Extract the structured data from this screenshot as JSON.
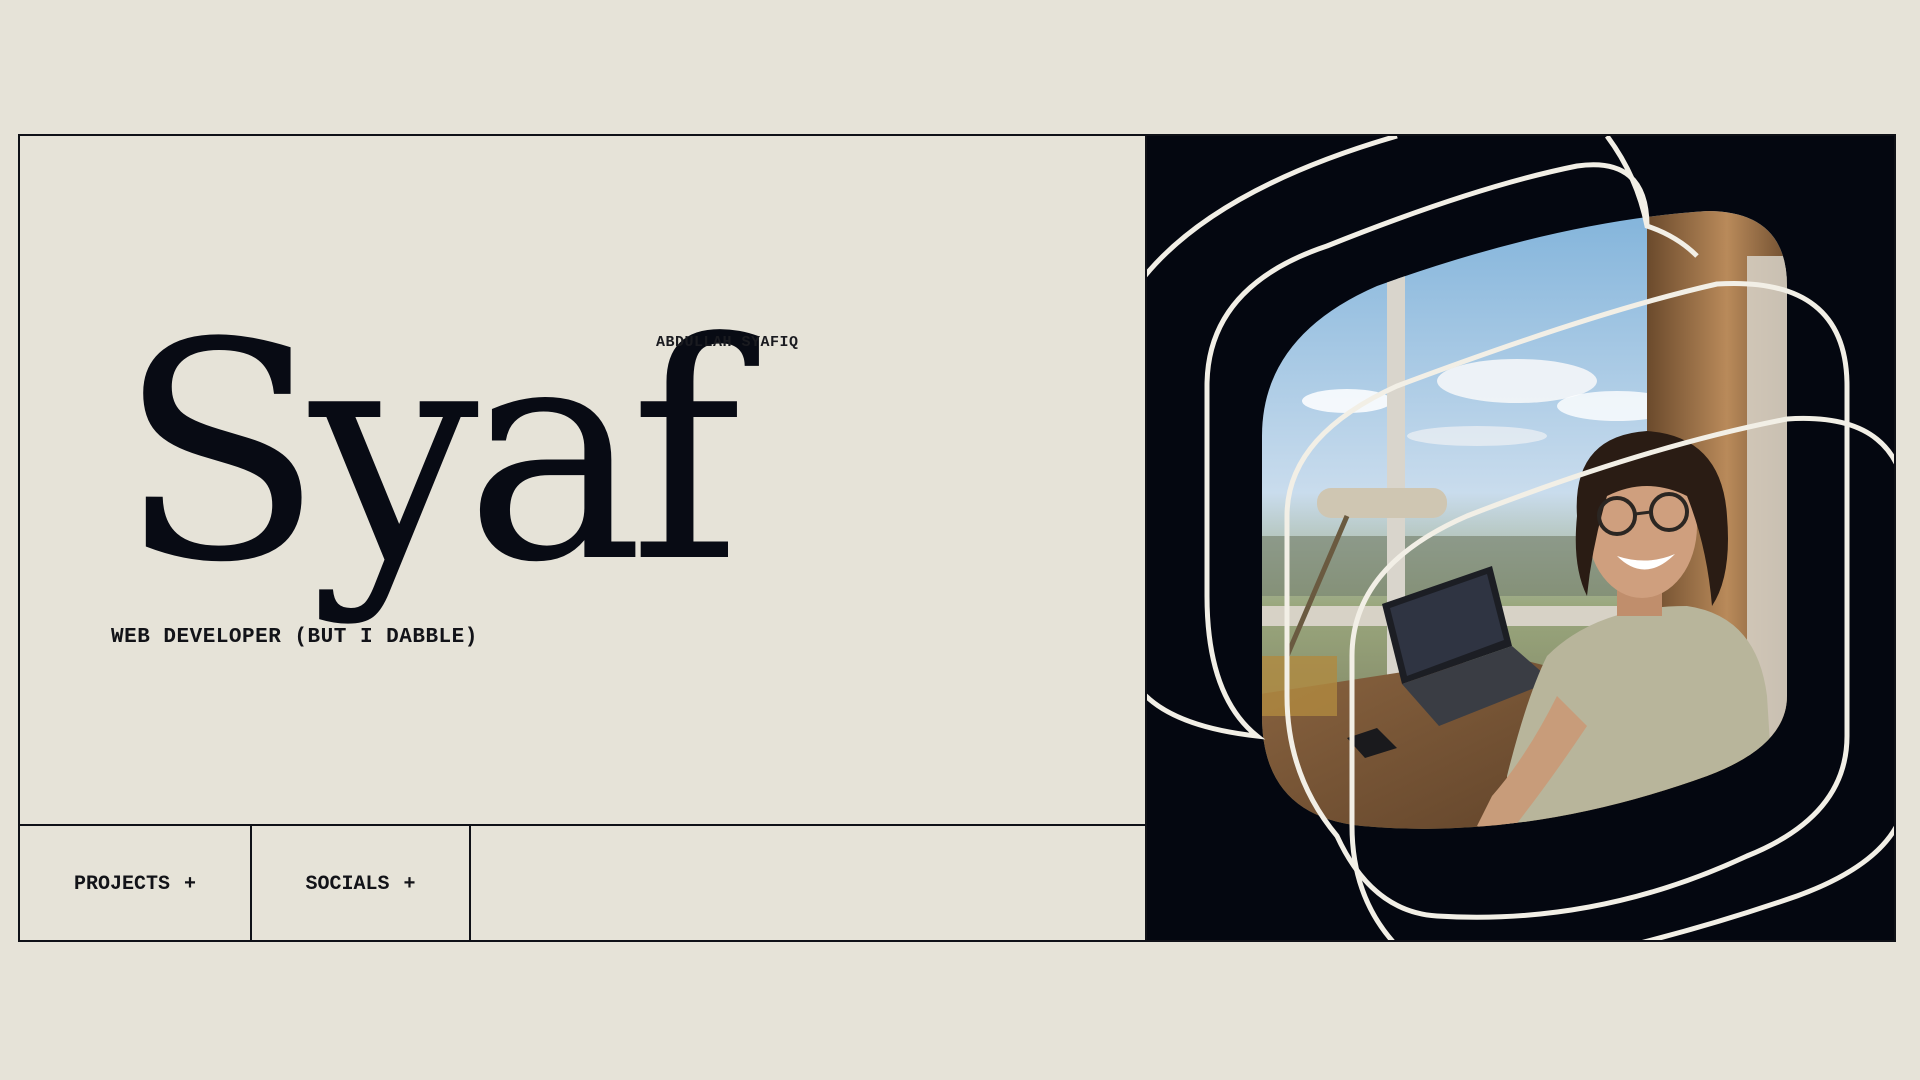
{
  "profile": {
    "nickname": "Syaf",
    "full_name": "ABDULLAH SYAFIQ",
    "role": "WEB DEVELOPER (BUT I DABBLE)"
  },
  "nav": {
    "projects_label": "PROJECTS",
    "projects_icon": "+",
    "socials_label": "SOCIALS",
    "socials_icon": "+"
  },
  "colors": {
    "background": "#e6e3d8",
    "ink": "#0f1117",
    "photo_panel": "#040710",
    "ring_stroke": "#f2efe6"
  },
  "photo": {
    "description_icon": "portrait-photo"
  }
}
